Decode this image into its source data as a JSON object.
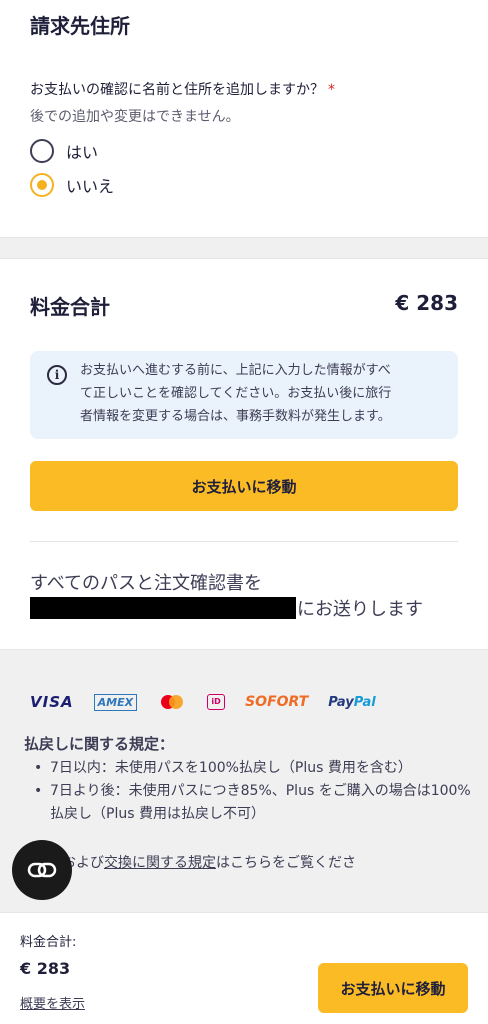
{
  "billing": {
    "title": "請求先住所",
    "question": "お支払いの確認に名前と住所を追加しますか？",
    "required_mark": "*",
    "note": "後での追加や変更はできません。",
    "options": [
      {
        "label": "はい",
        "selected": false
      },
      {
        "label": "いいえ",
        "selected": true
      }
    ]
  },
  "total": {
    "title": "料金合計",
    "amount": "€ 283",
    "info_lines": [
      "お支払いへ進むする前に、上記に入力した情報がすべ",
      "て正しいことを確認してください。お支払い後に旅行",
      "者情報を変更する場合は、事務手数料が発生します。"
    ],
    "pay_button": "お支払いに移動",
    "send_line1": "すべてのパスと注文確認書を",
    "send_suffix": "にお送りします"
  },
  "payment_logos": {
    "visa": "VISA",
    "amex": "AMEX",
    "ideal": "iD",
    "sofort": "SOFORT",
    "paypal_a": "Pay",
    "paypal_b": "Pal"
  },
  "refund": {
    "title": "払戻しに関する規定：",
    "items": [
      "7日以内：未使用パスを100%払戻し（Plus 費用を含む）",
      "7日より後：未使用パスにつき85%、Plus をご購入の場合は100%払戻し（Plus 費用は払戻し不可）"
    ],
    "policy_prefix": "および",
    "policy_link": "交換に関する規定",
    "policy_suffix": "はこちらをご覧くださ"
  },
  "bottom_bar": {
    "label": "料金合計:",
    "amount": "€ 283",
    "summary_link": "概要を表示",
    "pay_button": "お支払いに移動"
  },
  "colors": {
    "accent": "#fbbb24",
    "radio_selected": "#f5b21e",
    "info_bg": "#eaf2fb",
    "required": "#d6282a"
  }
}
